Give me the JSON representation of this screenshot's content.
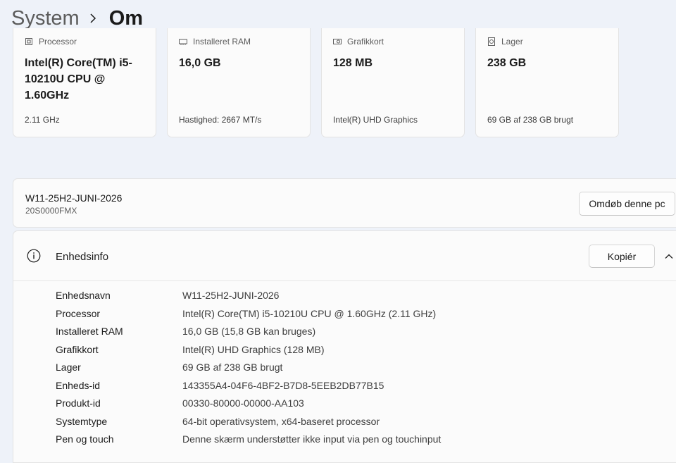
{
  "breadcrumb": {
    "parent": "System",
    "current": "Om"
  },
  "spec_cards": [
    {
      "title": "Processor",
      "value": "Intel(R) Core(TM) i5-10210U CPU @ 1.60GHz",
      "sub": "2.11 GHz",
      "icon": "processor-icon"
    },
    {
      "title": "Installeret RAM",
      "value": "16,0 GB",
      "sub": "Hastighed: 2667 MT/s",
      "icon": "ram-icon"
    },
    {
      "title": "Grafikkort",
      "value": "128 MB",
      "sub": "Intel(R) UHD Graphics",
      "icon": "graphics-card-icon"
    },
    {
      "title": "Lager",
      "value": "238 GB",
      "sub": "69 GB af 238 GB brugt",
      "icon": "storage-icon"
    }
  ],
  "pc": {
    "name": "W11-25H2-JUNI-2026",
    "model": "20S0000FMX",
    "rename_label": "Omdøb denne pc"
  },
  "device_info": {
    "title": "Enhedsinfo",
    "copy_label": "Kopiér",
    "rows": [
      {
        "label": "Enhedsnavn",
        "value": "W11-25H2-JUNI-2026"
      },
      {
        "label": "Processor",
        "value": "Intel(R) Core(TM) i5-10210U CPU @ 1.60GHz (2.11 GHz)"
      },
      {
        "label": "Installeret RAM",
        "value": "16,0 GB (15,8 GB kan bruges)"
      },
      {
        "label": "Grafikkort",
        "value": "Intel(R) UHD Graphics (128 MB)"
      },
      {
        "label": "Lager",
        "value": "69 GB af 238 GB brugt"
      },
      {
        "label": "Enheds-id",
        "value": "143355A4-04F6-4BF2-B7D8-5EEB2DB77B15"
      },
      {
        "label": "Produkt-id",
        "value": "00330-80000-00000-AA103"
      },
      {
        "label": "Systemtype",
        "value": "64-bit operativsystem, x64-baseret processor"
      },
      {
        "label": "Pen og touch",
        "value": "Denne skærm understøtter ikke input via pen og touchinput"
      }
    ]
  },
  "colors": {
    "page_background": "#eef2f9",
    "card_background": "#fbfbfb",
    "text_primary": "#1b1b1b",
    "text_secondary": "#5c5c5c"
  }
}
